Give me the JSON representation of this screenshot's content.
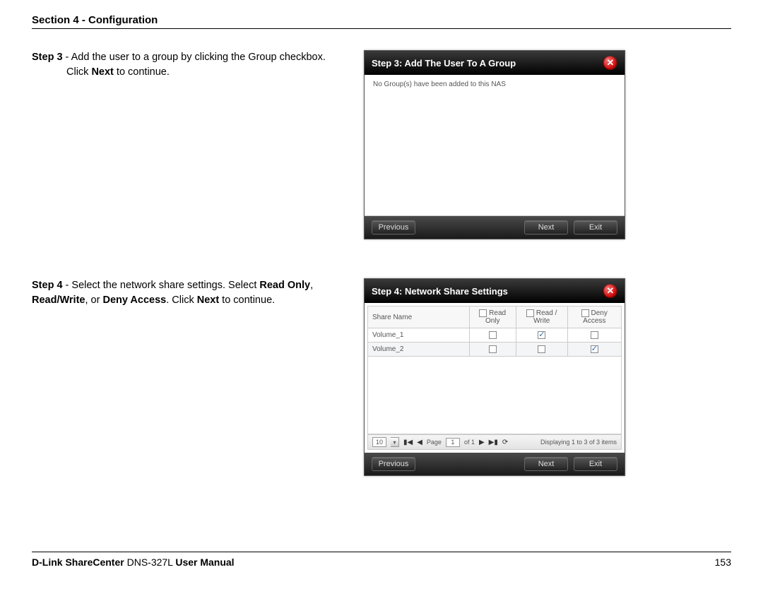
{
  "header": {
    "section": "Section 4 - Configuration"
  },
  "step3": {
    "label": "Step 3",
    "dash": " - ",
    "line1": "Add the user to a group by clicking the Group checkbox.",
    "line2_pre": "Click ",
    "line2_bold": "Next",
    "line2_post": " to continue."
  },
  "dialog1": {
    "title": "Step 3: Add The User To A Group",
    "body": "No Group(s) have been added to this NAS",
    "prev": "Previous",
    "next": "Next",
    "exit": "Exit"
  },
  "step4": {
    "label": "Step 4",
    "dash": " - ",
    "t1": "Select the network share settings. Select ",
    "b1": "Read Only",
    "t2": ", ",
    "b2": "Read/Write",
    "t3": ", or ",
    "b3": "Deny Access",
    "t4": ". Click ",
    "b4": "Next",
    "t5": " to continue."
  },
  "dialog2": {
    "title": "Step 4: Network Share Settings",
    "cols": {
      "name": "Share Name",
      "ro": "Read Only",
      "rw": "Read / Write",
      "da": "Deny Access"
    },
    "rows": [
      {
        "name": "Volume_1",
        "ro": false,
        "rw": true,
        "da": false
      },
      {
        "name": "Volume_2",
        "ro": false,
        "rw": false,
        "da": true
      }
    ],
    "pager": {
      "pageSize": "10",
      "pageLabel": "Page",
      "page": "1",
      "of": "of 1",
      "status": "Displaying 1 to 3 of 3 items"
    },
    "prev": "Previous",
    "next": "Next",
    "exit": "Exit"
  },
  "footer": {
    "brand_bold1": "D-Link ShareCenter",
    "model": " DNS-327L ",
    "brand_bold2": "User Manual",
    "page": "153"
  }
}
